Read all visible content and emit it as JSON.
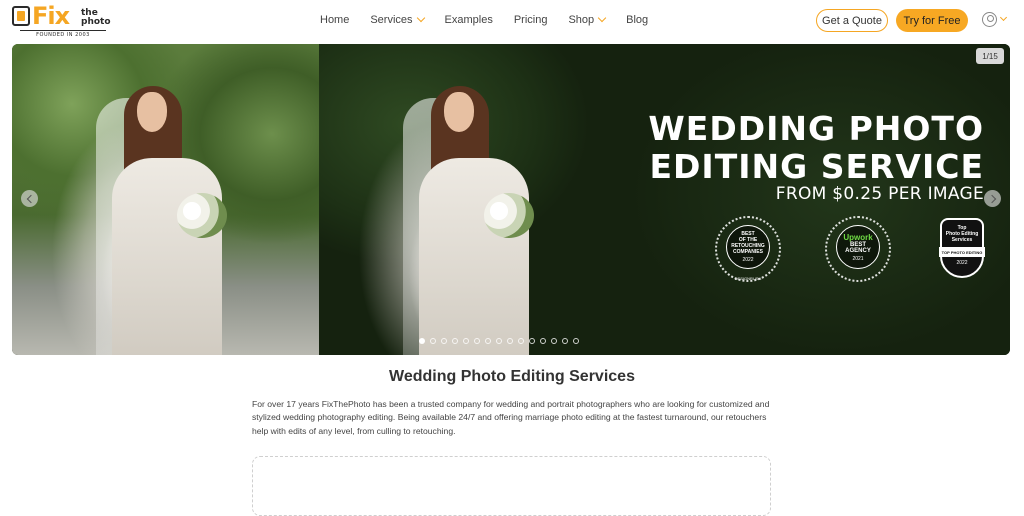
{
  "brand": {
    "name_fix": "Fix",
    "name_the": "the",
    "name_photo": "photo",
    "tagline": "FOUNDED IN 2003",
    "accent_color": "#f5a623"
  },
  "nav": {
    "items": [
      {
        "label": "Home",
        "has_dropdown": false
      },
      {
        "label": "Services",
        "has_dropdown": true
      },
      {
        "label": "Examples",
        "has_dropdown": false
      },
      {
        "label": "Pricing",
        "has_dropdown": false
      },
      {
        "label": "Shop",
        "has_dropdown": true
      },
      {
        "label": "Blog",
        "has_dropdown": false
      }
    ],
    "quote_button": "Get a Quote",
    "try_button": "Try for Free",
    "user_icon": "user-icon"
  },
  "hero": {
    "counter": "1/15",
    "title_line1": "WEDDING PHOTO",
    "title_line2": "EDITING SERVICE",
    "subtitle": "FROM $0.25 PER IMAGE",
    "slides_total": 15,
    "active_slide": 1,
    "badges": [
      {
        "lines": [
          "BEST",
          "OF THE",
          "RETOUCHING",
          "COMPANIES"
        ],
        "year": "2022",
        "foot": "DESIGNRUSH"
      },
      {
        "brand": "Upwork",
        "lines": [
          "BEST AGENCY"
        ],
        "year": "2021"
      },
      {
        "lines": [
          "Top",
          "Photo Editing",
          "Services"
        ],
        "ribbon": "TOP PHOTO EDITING",
        "year": "2022"
      }
    ]
  },
  "content": {
    "title": "Wedding Photo Editing Services",
    "description": "For over 17 years FixThePhoto has been a trusted company for wedding and portrait photographers who are looking for customized and stylized wedding photography editing. Being available 24/7 and offering marriage photo editing at the fastest turnaround, our retouchers help with edits of any level, from culling to retouching."
  }
}
